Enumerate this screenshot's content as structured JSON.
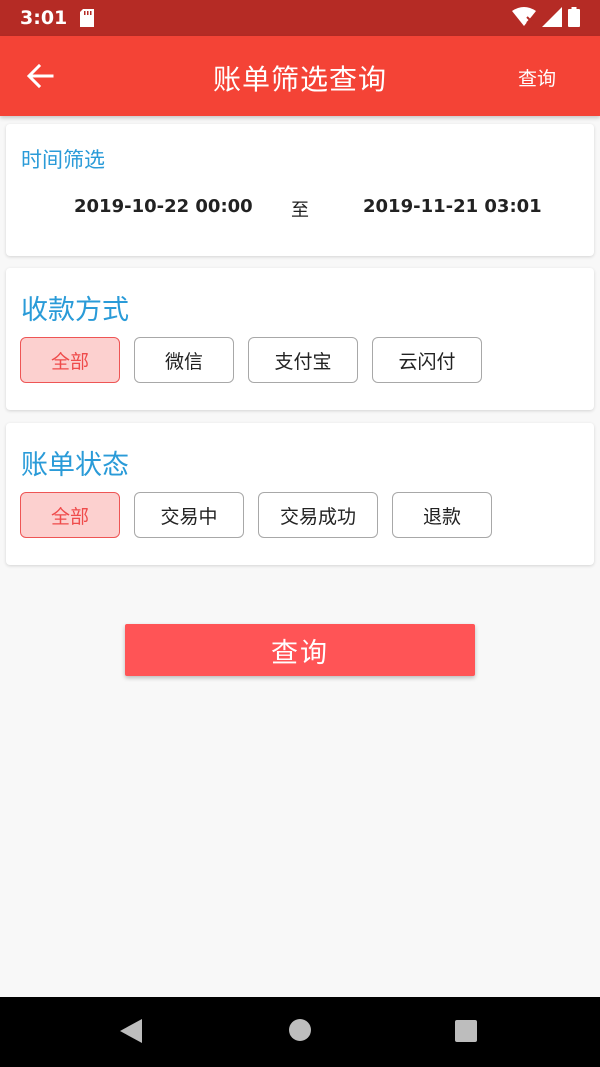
{
  "status_bar": {
    "time": "3:01",
    "icons": [
      "sd-card-icon",
      "wifi-icon",
      "signal-icon",
      "battery-icon"
    ]
  },
  "app_bar": {
    "title": "账单筛选查询",
    "action_label": "查询",
    "back_icon": "arrow-left-icon",
    "background": "#f44336"
  },
  "time_filter": {
    "label": "时间筛选",
    "start": "2019-10-22 00:00",
    "separator": "至",
    "end": "2019-11-21 03:01"
  },
  "payment_method": {
    "title": "收款方式",
    "options": [
      "全部",
      "微信",
      "支付宝",
      "云闪付"
    ],
    "selected": "全部"
  },
  "bill_status": {
    "title": "账单状态",
    "options": [
      "全部",
      "交易中",
      "交易成功",
      "退款"
    ],
    "selected": "全部"
  },
  "submit": {
    "label": "查询",
    "color": "#ff5456"
  },
  "colors": {
    "accent_blue": "#2a9bd8",
    "selected_chip_bg": "#fcd0cf",
    "selected_chip_border": "#ee5555"
  },
  "nav_bar": {
    "icons": [
      "nav-back-icon",
      "nav-home-icon",
      "nav-recent-icon"
    ]
  }
}
